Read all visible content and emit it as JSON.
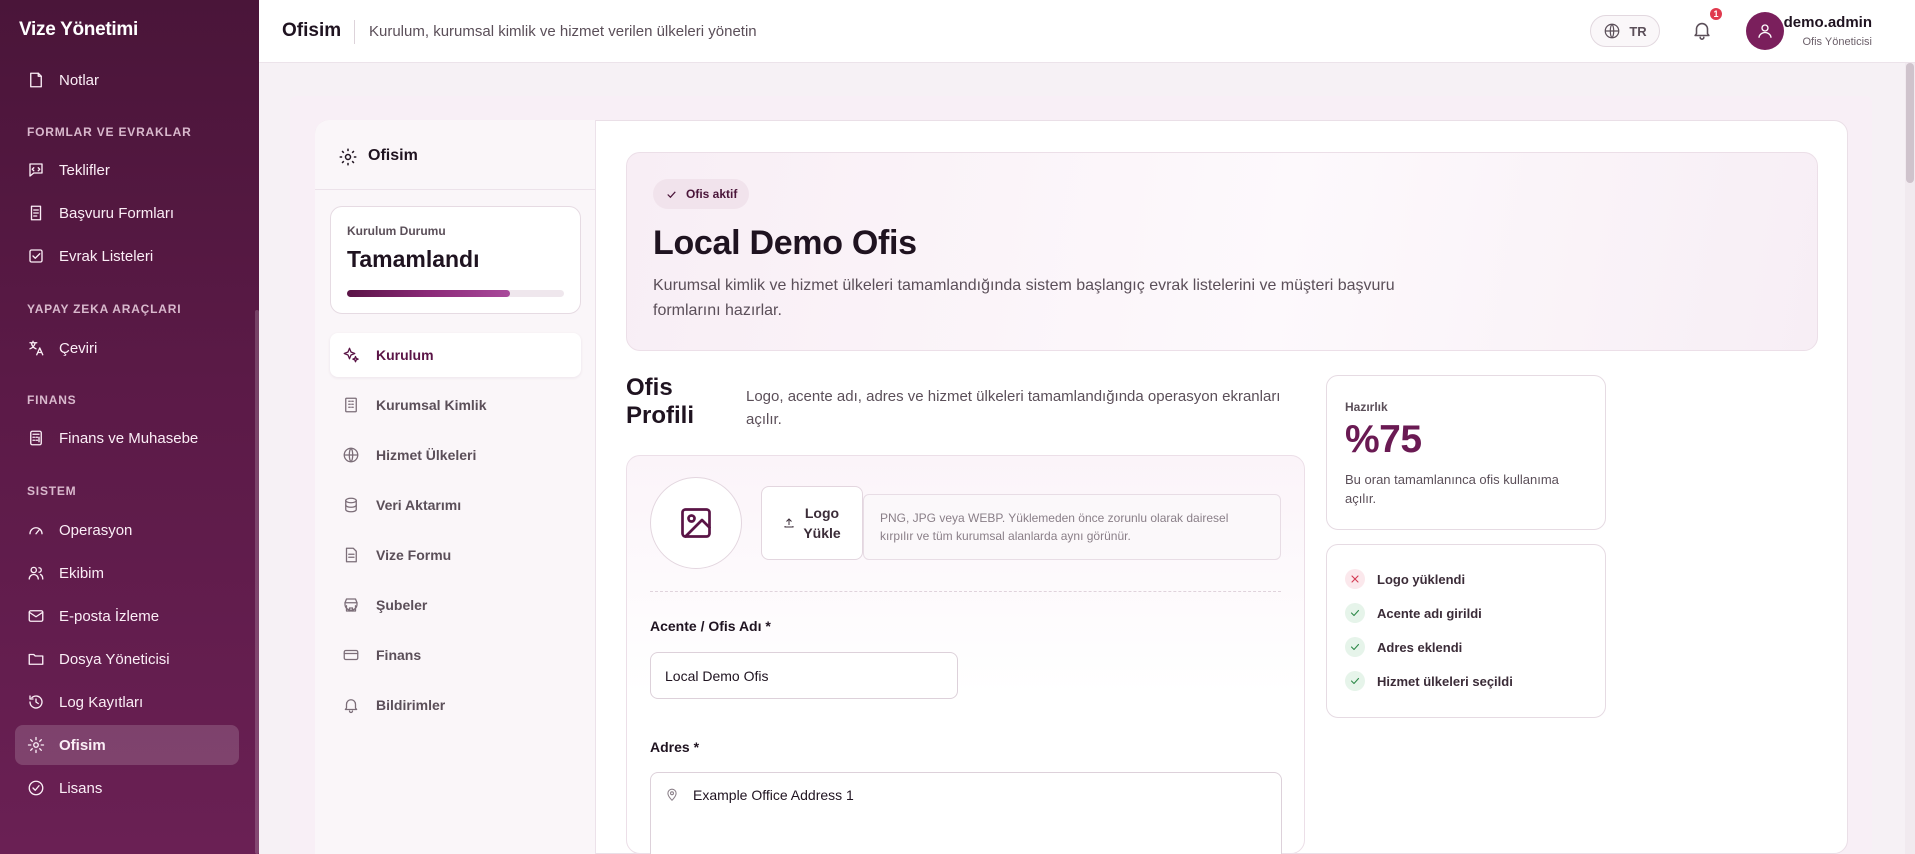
{
  "brand": "Vize Yönetimi",
  "sidebar": {
    "sections": {
      "forms": "FORMLAR VE EVRAKLAR",
      "ai": "YAPAY ZEKA ARAÇLARI",
      "finance": "FINANS",
      "system": "SISTEM"
    },
    "items": {
      "notes": "Notlar",
      "offers": "Teklifler",
      "application_forms": "Başvuru Formları",
      "document_lists": "Evrak Listeleri",
      "translate": "Çeviri",
      "finance": "Finans ve Muhasebe",
      "operation": "Operasyon",
      "team": "Ekibim",
      "email": "E-posta İzleme",
      "files": "Dosya Yöneticisi",
      "logs": "Log Kayıtları",
      "office": "Ofisim",
      "license": "Lisans"
    }
  },
  "topbar": {
    "title": "Ofisim",
    "subtitle": "Kurulum, kurumsal kimlik ve hizmet verilen ülkeleri yönetin",
    "language": "TR",
    "notification_count": "1",
    "user_name": "demo.admin",
    "user_role": "Ofis Yöneticisi"
  },
  "settings_nav": {
    "title": "Ofisim",
    "status_label": "Kurulum Durumu",
    "status_value": "Tamamlandı",
    "status_progress": 0.75,
    "items": {
      "setup": "Kurulum",
      "identity": "Kurumsal Kimlik",
      "countries": "Hizmet Ülkeleri",
      "import": "Veri Aktarımı",
      "visa_form": "Vize Formu",
      "branches": "Şubeler",
      "finance": "Finans",
      "notifications": "Bildirimler"
    }
  },
  "hero": {
    "badge": "Ofis aktif",
    "title": "Local Demo Ofis",
    "description": "Kurumsal kimlik ve hizmet ülkeleri tamamlandığında sistem başlangıç evrak listelerini ve müşteri başvuru formlarını hazırlar."
  },
  "profile": {
    "title": "Ofis Profili",
    "description": "Logo, acente adı, adres ve hizmet ülkeleri tamamlandığında operasyon ekranları açılır.",
    "upload_label_1": "Logo",
    "upload_label_2": "Yükle",
    "upload_hint": "PNG, JPG veya WEBP. Yüklemeden önce zorunlu olarak dairesel kırpılır ve tüm kurumsal alanlarda aynı görünür.",
    "name_label": "Acente / Ofis Adı *",
    "name_value": "Local Demo Ofis",
    "address_label": "Adres *",
    "address_value": "Example Office Address 1"
  },
  "readiness": {
    "label": "Hazırlık",
    "value": "%75",
    "description": "Bu oran tamamlanınca ofis kullanıma açılır."
  },
  "checklist": [
    {
      "label": "Logo yüklendi",
      "done": false
    },
    {
      "label": "Acente adı girildi",
      "done": true
    },
    {
      "label": "Adres eklendi",
      "done": true
    },
    {
      "label": "Hizmet ülkeleri seçildi",
      "done": true
    }
  ],
  "colors": {
    "brand": "#5a1446",
    "accent": "#6a1a53",
    "success": "#2f8a4a",
    "danger": "#d33a52"
  }
}
